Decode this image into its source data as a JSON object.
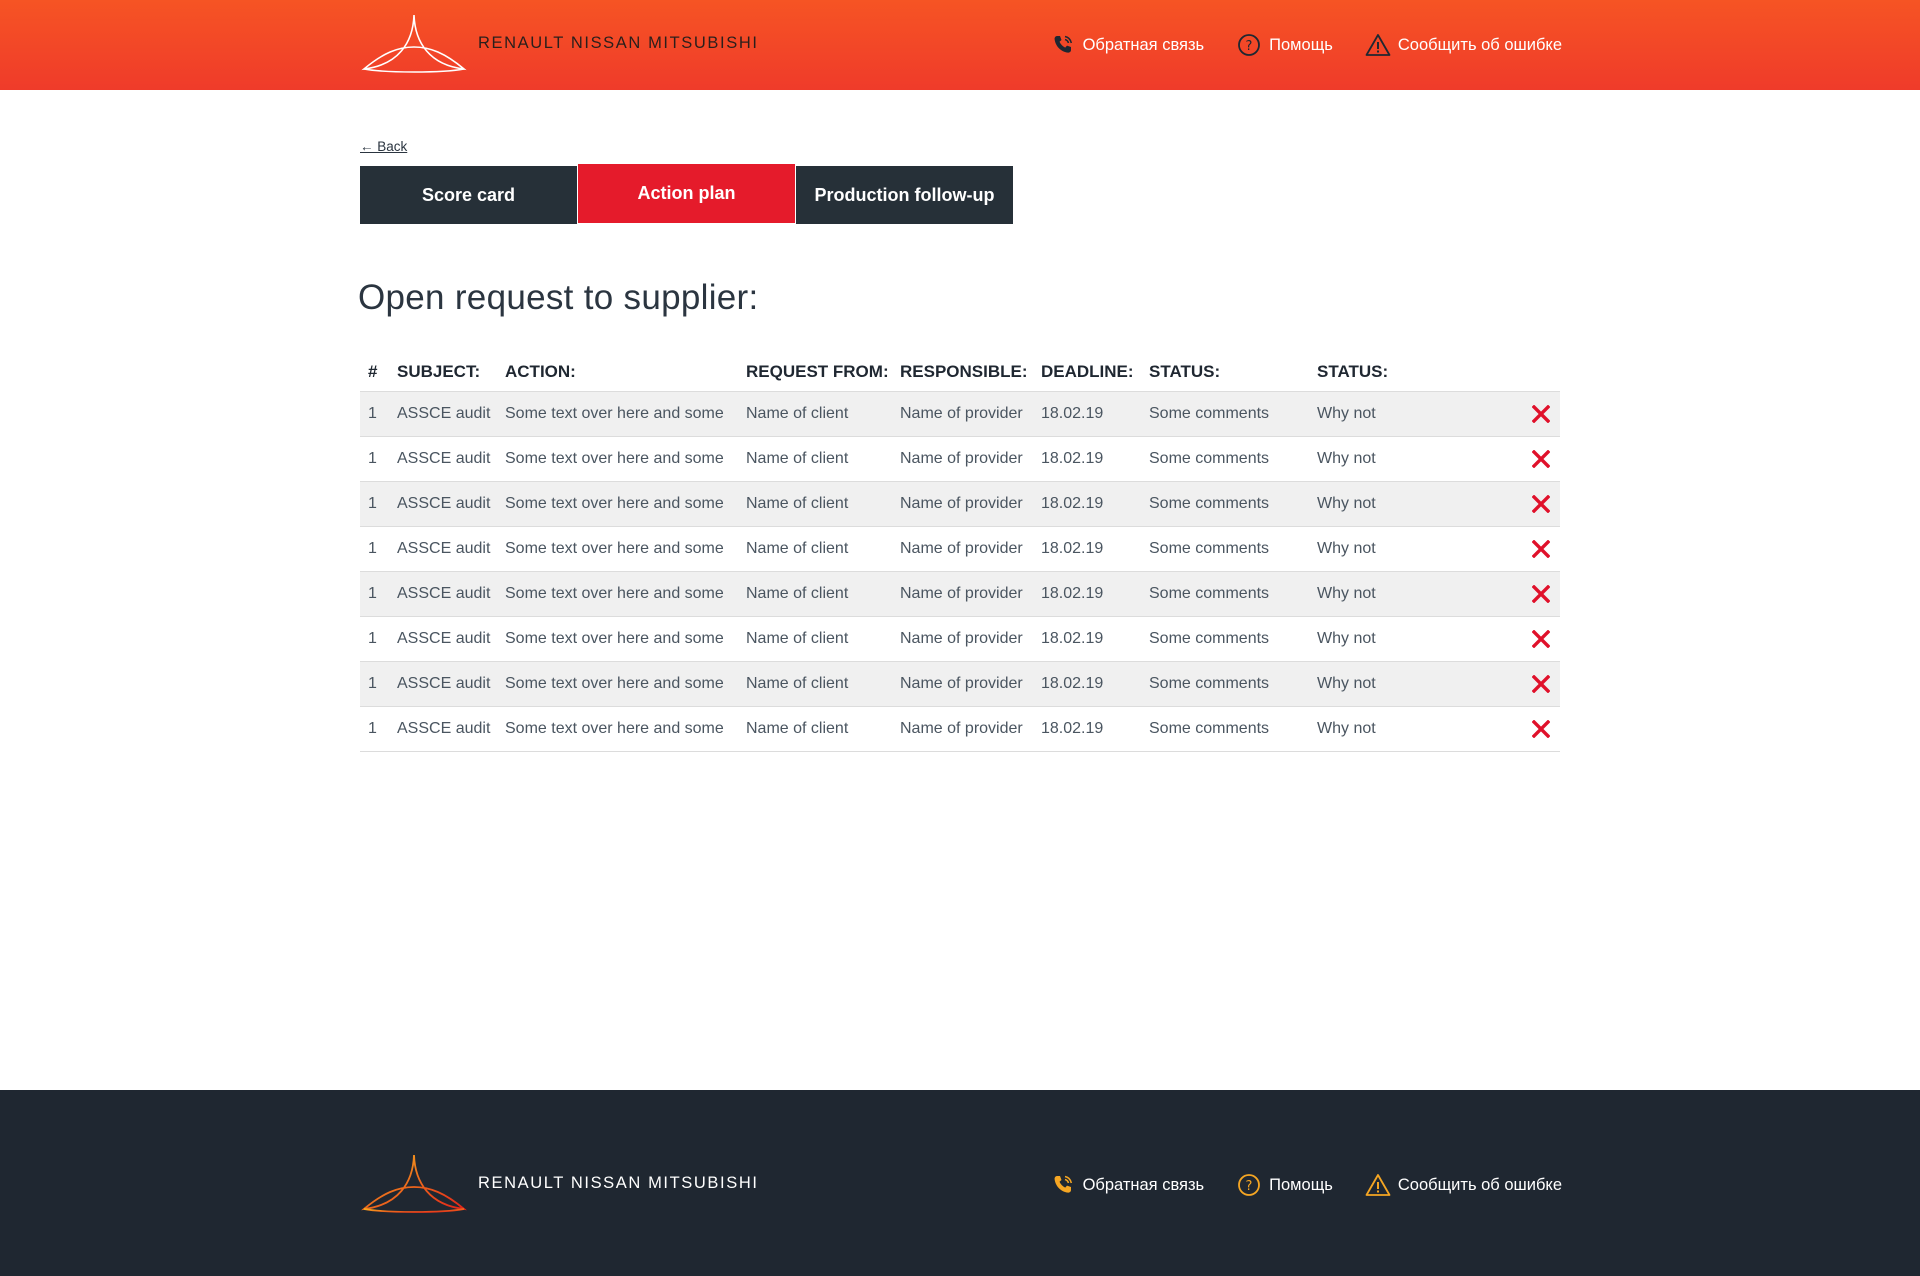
{
  "brand": {
    "logo_text": "RENAULT NISSAN MITSUBISHI"
  },
  "header": {
    "links": [
      {
        "label": "Обратная связь",
        "icon": "phone-icon"
      },
      {
        "label": "Помощь",
        "icon": "help-circle-icon"
      },
      {
        "label": "Сообщить об ошибке",
        "icon": "warning-icon"
      }
    ]
  },
  "nav": {
    "back_label": "← Back"
  },
  "tabs": [
    {
      "label": "Score card",
      "active": false
    },
    {
      "label": "Action plan",
      "active": true
    },
    {
      "label": "Production follow-up",
      "active": false
    }
  ],
  "page": {
    "title": "Open request to supplier:"
  },
  "table": {
    "columns": [
      "#",
      "SUBJECT:",
      "ACTION:",
      "REQUEST FROM:",
      "RESPONSIBLE:",
      "DEADLINE:",
      "STATUS:",
      "STATUS:"
    ],
    "rows": [
      [
        "1",
        "ASSCE audit",
        "Some text over here and some",
        "Name of  client",
        "Name of provider",
        "18.02.19",
        "Some comments",
        "Why not"
      ],
      [
        "1",
        "ASSCE audit",
        "Some text over here and some",
        "Name of  client",
        "Name of provider",
        "18.02.19",
        "Some comments",
        "Why not"
      ],
      [
        "1",
        "ASSCE audit",
        "Some text over here and some",
        "Name of  client",
        "Name of provider",
        "18.02.19",
        "Some comments",
        "Why not"
      ],
      [
        "1",
        "ASSCE audit",
        "Some text over here and some",
        "Name of  client",
        "Name of provider",
        "18.02.19",
        "Some comments",
        "Why not"
      ],
      [
        "1",
        "ASSCE audit",
        "Some text over here and some",
        "Name of  client",
        "Name of provider",
        "18.02.19",
        "Some comments",
        "Why not"
      ],
      [
        "1",
        "ASSCE audit",
        "Some text over here and some",
        "Name of  client",
        "Name of provider",
        "18.02.19",
        "Some comments",
        "Why not"
      ],
      [
        "1",
        "ASSCE audit",
        "Some text over here and some",
        "Name of  client",
        "Name of provider",
        "18.02.19",
        "Some comments",
        "Why not"
      ],
      [
        "1",
        "ASSCE audit",
        "Some text over here and some",
        "Name of  client",
        "Name of provider",
        "18.02.19",
        "Some comments",
        "Why not"
      ]
    ],
    "row_action_icon": "close-icon"
  },
  "footer": {
    "links": [
      {
        "label": "Обратная связь",
        "icon": "phone-icon"
      },
      {
        "label": "Помощь",
        "icon": "help-circle-icon"
      },
      {
        "label": "Сообщить об ошибке",
        "icon": "warning-icon"
      }
    ]
  },
  "colors": {
    "header_gradient_top": "#f65424",
    "header_gradient_bottom": "#ef3b2a",
    "tab_dark": "#263038",
    "tab_active": "#e51b2b",
    "delete_red": "#e0112b",
    "footer_bg": "#1f2731",
    "footer_icon": "#f5a623"
  }
}
